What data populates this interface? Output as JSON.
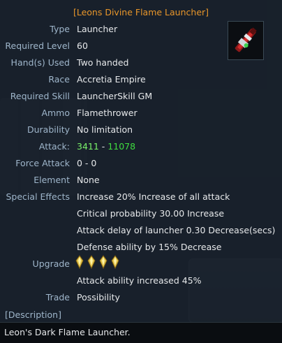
{
  "item": {
    "name": "[Leons Divine Flame Launcher]",
    "icon": "flame-launcher-weapon-icon"
  },
  "stats": [
    {
      "label": "Type",
      "value": "Launcher"
    },
    {
      "label": "Required Level",
      "value": "60"
    },
    {
      "label": "Hand(s) Used",
      "value": "Two handed"
    },
    {
      "label": "Race",
      "value": "Accretia Empire"
    },
    {
      "label": "Required Skill",
      "value": "LauncherSkill GM"
    },
    {
      "label": "Ammo",
      "value": "Flamethrower"
    },
    {
      "label": "Durability",
      "value": "No limitation"
    }
  ],
  "attack": {
    "label": "Attack:",
    "min": "3411",
    "sep": "-",
    "max": "11078"
  },
  "force_attack": {
    "label": "Force Attack",
    "value": "0 - 0"
  },
  "element": {
    "label": "Element",
    "value": "None"
  },
  "special_effects": {
    "label": "Special Effects",
    "lines": [
      "Increase 20% Increase of all attack",
      "Critical probability 30.00 Increase",
      "Attack delay of launcher 0.30 Decrease(secs)",
      "Defense ability by 15% Decrease"
    ]
  },
  "upgrade": {
    "label": "Upgrade",
    "count": 4,
    "icon": "talic-gem-icon"
  },
  "upgrade_effect": "Attack ability increased 45%",
  "trade": {
    "label": "Trade",
    "value": "Possibility"
  },
  "description": {
    "label": "[Description]",
    "text": "Leon's Dark Flame Launcher."
  },
  "colors": {
    "title": "#e8962a",
    "label": "#9fb6cb",
    "value": "#e6e8ea",
    "attack_min": "#7af36a",
    "attack_max": "#3fdc3f"
  }
}
